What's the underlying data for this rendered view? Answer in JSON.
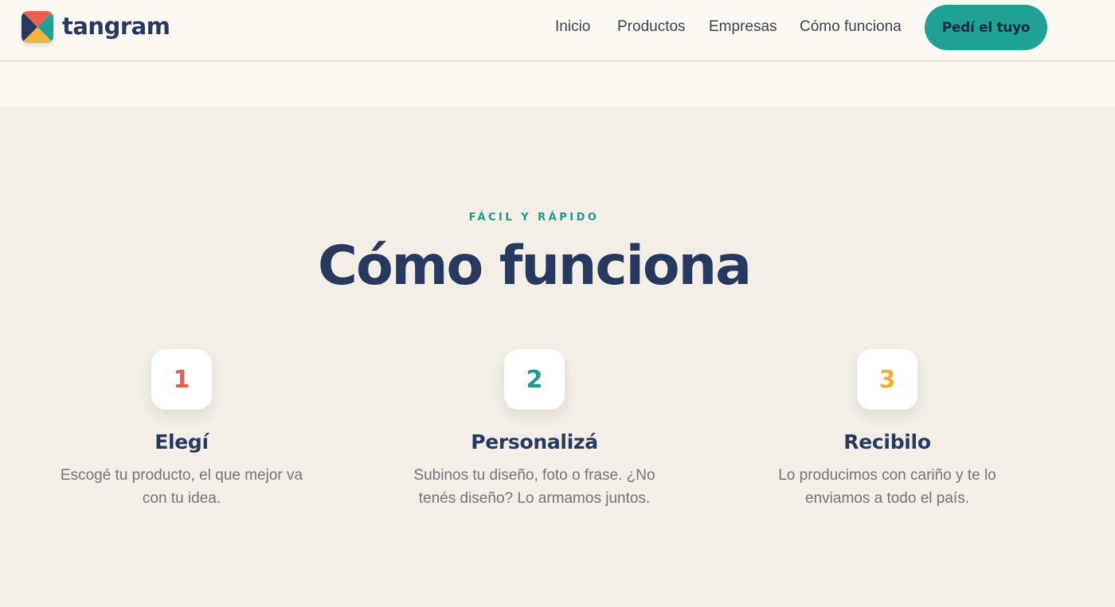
{
  "brand": {
    "name": "tangram",
    "logo_icon": "tangram-logo-icon",
    "colors": {
      "coral": "#e9614c",
      "teal": "#1fa294",
      "yellow": "#f2b440",
      "navy": "#27395f"
    }
  },
  "nav": {
    "items": [
      {
        "label": "Inicio"
      },
      {
        "label": "Productos"
      },
      {
        "label": "Empresas"
      },
      {
        "label": "Cómo funciona"
      }
    ],
    "cta_label": "Pedí el tuyo"
  },
  "how_it_works": {
    "eyebrow": "FÁCIL Y RÁPIDO",
    "title": "Cómo funciona",
    "steps": [
      {
        "number": "1",
        "title": "Elegí",
        "text": "Escogé tu producto, el que mejor va con tu idea.",
        "color": "#e2604d"
      },
      {
        "number": "2",
        "title": "Personalizá",
        "text": "Subinos tu diseño, foto o frase. ¿No tenés diseño? Lo armamos juntos.",
        "color": "#1f9a8d"
      },
      {
        "number": "3",
        "title": "Recibilo",
        "text": "Lo producimos con cariño y te lo enviamos a todo el país.",
        "color": "#eeae3b"
      }
    ]
  }
}
